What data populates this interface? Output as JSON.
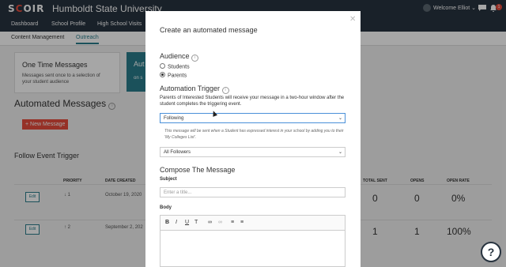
{
  "topbar": {
    "logo_prefix": "S",
    "logo_c": "C",
    "logo_rest": "OIR",
    "university": "Humboldt State University",
    "welcome": "Welcome Elliot",
    "notif_count": "1"
  },
  "nav1": [
    "Dashboard",
    "School Profile",
    "High School Visits"
  ],
  "nav2": {
    "content_mgmt": "Content Management",
    "outreach": "Outreach"
  },
  "cards": {
    "one_time_title": "One Time Messages",
    "one_time_desc": "Messages sent once to a selection of your student audience",
    "auto_label": "Aut",
    "auto_sub": "on s"
  },
  "automated": {
    "title": "Automated Messages",
    "new_button": "+ New Message",
    "follow_title": "Follow Event Trigger"
  },
  "table": {
    "headers": [
      "PRIORITY",
      "DATE CREATED",
      "TOTAL SENT",
      "OPENS",
      "OPEN RATE"
    ],
    "rows": [
      {
        "edit": "Edit",
        "priority": "↓ 1",
        "date": "October 19, 2020",
        "total_sent": "0",
        "opens": "0",
        "open_rate": "0%"
      },
      {
        "edit": "Edit",
        "priority": "↑ 2",
        "date": "September 2, 202",
        "total_sent": "1",
        "opens": "1",
        "open_rate": "100%"
      }
    ]
  },
  "modal": {
    "title": "Create an automated message",
    "audience_heading": "Audience",
    "audience_options": [
      "Students",
      "Parents"
    ],
    "audience_selected": "Parents",
    "trigger_heading": "Automation Trigger",
    "trigger_desc": "Parents of Interested Students will receive your message in a two-hour window after the student completes the triggering event.",
    "trigger_value": "Following",
    "trigger_hint": "This message will be sent when a Student has expressed interest in your school by adding you to their 'My Colleges List'.",
    "followers_value": "All Followers",
    "compose_heading": "Compose The Message",
    "subject_label": "Subject",
    "subject_placeholder": "Enter a title...",
    "body_label": "Body"
  },
  "help_icon": "?",
  "colors": {
    "accent": "#2a7d8c",
    "brand_red": "#e74c3c",
    "nav_bg": "#27333f"
  }
}
